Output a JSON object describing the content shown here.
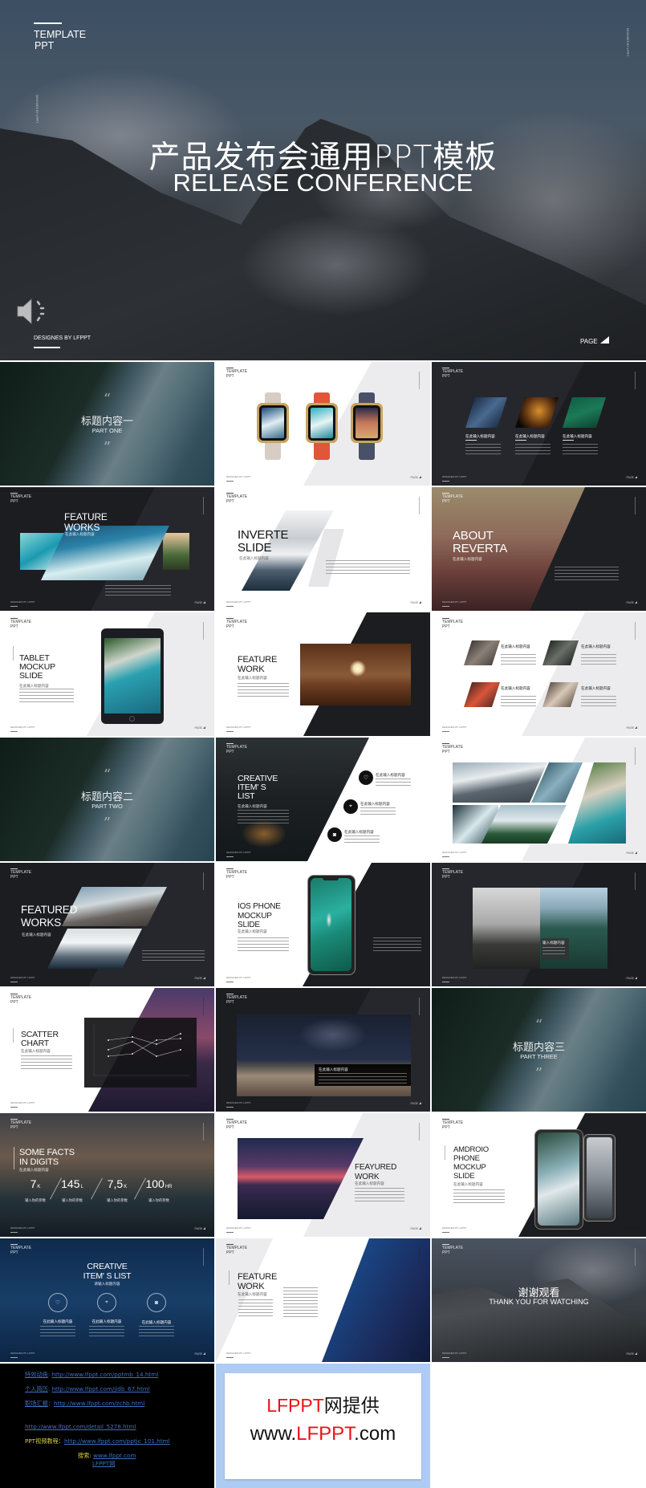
{
  "hero": {
    "template_label": "TEMPLATE",
    "ppt_label": "PPT",
    "title_cn": "产品发布会通用PPT模板",
    "title_en": "RELEASE CONFERENCE",
    "designer": "DESIGNES BY  LFPPT",
    "page": "PAGE",
    "vertical_text": "DESIGNES BY LFPPT"
  },
  "common": {
    "template_ppt": "TEMPLATE\nPPT",
    "designer": "DESIGNES BY LFPPT",
    "page": "PAGE",
    "quote_open": "“",
    "quote_close": "”"
  },
  "slides": [
    {
      "title": "标题内容一",
      "subtitle": "PART ONE"
    },
    {
      "band_colors": [
        "#d8cdc3",
        "#e0563a",
        "#4a5068"
      ]
    },
    {
      "captions": [
        "在此输入标题内容",
        "在此输入标题内容",
        "在此输入标题内容"
      ]
    },
    {
      "title": "FEATURE\nWORKS",
      "subtitle": "在此输入标题内容"
    },
    {
      "title": "INVERTE\nSLIDE",
      "subtitle": "在此输入标题内容"
    },
    {
      "title": "ABOUT\nREVERTA",
      "subtitle": "在此输入标题内容"
    },
    {
      "title": "TABLET\nMOCKUP\nSLIDE",
      "subtitle": "在此输入标题内容"
    },
    {
      "title": "FEATURE\nWORK",
      "subtitle": "在此输入标题内容"
    },
    {
      "captions": [
        "在此输入标题内容",
        "在此输入标题内容",
        "在此输入标题内容",
        "在此输入标题内容"
      ]
    },
    {
      "title": "标题内容二",
      "subtitle": "PART TWO"
    },
    {
      "title": "CREATIVE\nITEM' S\nLIST",
      "subtitle": "在此输入标题内容",
      "items": [
        "在此输入标题内容",
        "在此输入标题内容",
        "在此输入标题内容"
      ],
      "icons": [
        "heart-icon",
        "location-pin-icon",
        "camera-icon"
      ]
    },
    {},
    {
      "title": "FEATURED\nWORKS",
      "subtitle": "在此输入标题内容"
    },
    {
      "title": "IOS PHONE\nMOCKUP\nSLIDE",
      "subtitle": "在此输入标题内容"
    },
    {
      "caption": "输入标题内容"
    },
    {
      "title": "SCATTER\nCHART",
      "subtitle": "在此输入标题内容"
    },
    {
      "caption": "在此输入标题内容"
    },
    {
      "title": "标题内容三",
      "subtitle": "PART THREE"
    },
    {
      "title": "SOME FACTS\nIN DIGITS",
      "subtitle": "在此输入标题内容",
      "stats": [
        {
          "value": "7",
          "unit": "K",
          "label": "输入你的参数"
        },
        {
          "value": "145",
          "unit": "L",
          "label": "输入你的参数"
        },
        {
          "value": "7,5",
          "unit": "K",
          "label": "输入你的参数"
        },
        {
          "value": "100",
          "unit": "HR",
          "label": "输入你的参数"
        }
      ]
    },
    {
      "title": "FEAYURED\nWORK",
      "subtitle": "在此输入标题内容"
    },
    {
      "title": "AMDROIO\nPHONE\nMOCKUP\nSLIDE",
      "subtitle": "在此输入标题内容"
    },
    {
      "title": "CREATIVE\nITEM' S LIST",
      "subtitle": "请输入标题内容",
      "items": [
        "在此输入标题内容",
        "在此输入标题内容",
        "在此输入标题内容"
      ],
      "icons": [
        "heart-icon",
        "location-pin-icon",
        "camera-icon"
      ]
    },
    {
      "title": "FEATURE\nWORK",
      "subtitle": "在此输入标题内容"
    },
    {
      "title": "谢谢观看",
      "subtitle": "THANK YOU FOR WATCHING"
    }
  ],
  "links_panel": {
    "items": [
      {
        "label": "特效动画",
        "sep": ": ",
        "url": "http://www.lfppt.com/pptmb_14.html"
      },
      {
        "label": "个人简历",
        "sep": ": ",
        "url": "http://www.lfppt.com/jldb_67.html"
      },
      {
        "label": "职场汇报",
        "sep": "：",
        "url": "http://www.lfppt.com/zchb.html"
      }
    ],
    "faq_label": "PPT常见问题及修改教程：",
    "faq_url": "http://www.lfppt.com/detail_5278.html",
    "video_label": "PPT视频教程：",
    "video_url": "http://www.lfppt.com/pptjc_101.html",
    "search_label": "搜索: ",
    "search_url": "www.lfppt.com",
    "site_name": "LFPPT网"
  },
  "promo": {
    "line1_brand": "LFPPT",
    "line1_rest": "网提供",
    "line2_pre": "www.",
    "line2_brand": "LFPPT",
    "line2_post": ".com",
    "brand_color": "#e8141b",
    "panel_color": "#aecbf4"
  }
}
